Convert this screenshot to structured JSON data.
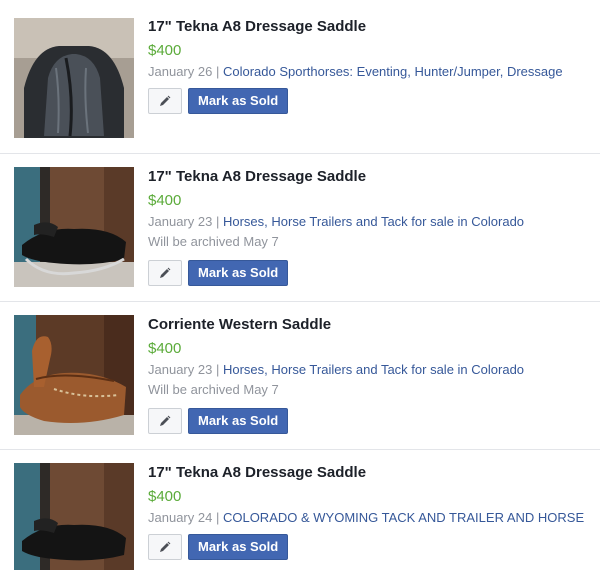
{
  "listings": [
    {
      "title": "17\" Tekna A8 Dressage Saddle",
      "price": "$400",
      "date": "January 26",
      "separator": "|",
      "group": "Colorado Sporthorses: Eventing, Hunter/Jumper, Dressage",
      "archived": "",
      "edit_icon": "pencil-icon",
      "mark_sold_label": "Mark as Sold"
    },
    {
      "title": "17\" Tekna A8 Dressage Saddle",
      "price": "$400",
      "date": "January 23",
      "separator": "|",
      "group": "Horses, Horse Trailers and Tack for sale in Colorado",
      "archived": "Will be archived May 7",
      "edit_icon": "pencil-icon",
      "mark_sold_label": "Mark as Sold"
    },
    {
      "title": "Corriente Western Saddle",
      "price": "$400",
      "date": "January 23",
      "separator": "|",
      "group": "Horses, Horse Trailers and Tack for sale in Colorado",
      "archived": "Will be archived May 7",
      "edit_icon": "pencil-icon",
      "mark_sold_label": "Mark as Sold"
    },
    {
      "title": "17\" Tekna A8 Dressage Saddle",
      "price": "$400",
      "date": "January 24",
      "separator": "|",
      "group": "COLORADO & WYOMING TACK AND TRAILER AND HORSE",
      "archived": "",
      "edit_icon": "pencil-icon",
      "mark_sold_label": "Mark as Sold"
    }
  ],
  "colors": {
    "price": "#5bab3a",
    "group_link": "#365899",
    "button_blue": "#4267b2",
    "meta_gray": "#90949c"
  }
}
